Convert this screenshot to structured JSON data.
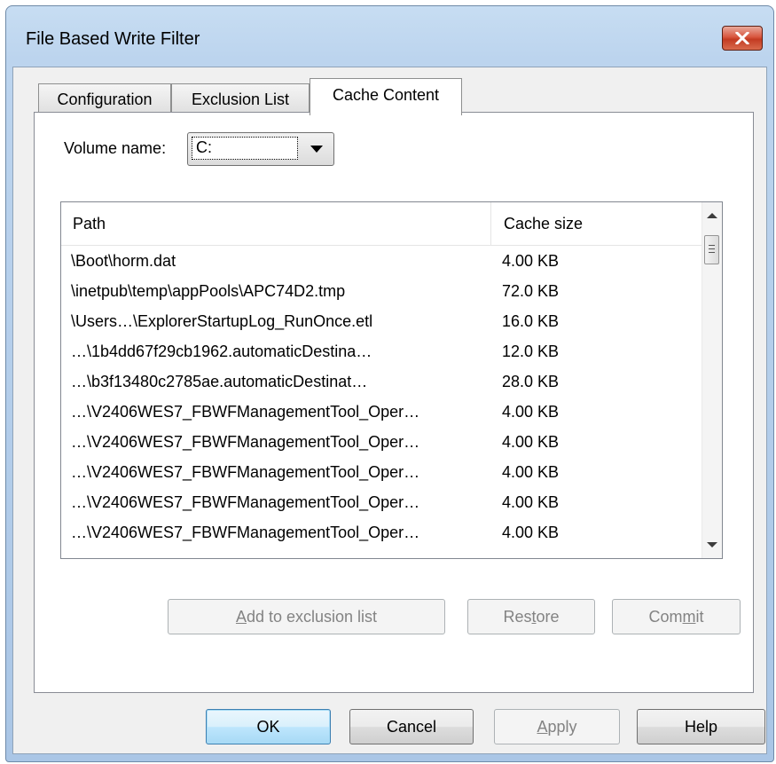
{
  "window": {
    "title": "File Based Write Filter",
    "close_icon": "close-icon"
  },
  "tabs": [
    {
      "label": "Configuration",
      "active": false
    },
    {
      "label": "Exclusion List",
      "active": false
    },
    {
      "label": "Cache Content",
      "active": true
    }
  ],
  "cache_content": {
    "volume_label": "Volume name:",
    "volume_value": "C:",
    "columns": {
      "path": "Path",
      "cache_size": "Cache size"
    },
    "rows": [
      {
        "path": "\\Boot\\horm.dat",
        "size": "4.00 KB"
      },
      {
        "path": "\\inetpub\\temp\\appPools\\APC74D2.tmp",
        "size": "72.0 KB"
      },
      {
        "path": "\\Users…\\ExplorerStartupLog_RunOnce.etl",
        "size": "16.0 KB"
      },
      {
        "path": "…\\1b4dd67f29cb1962.automaticDestina…",
        "size": "12.0 KB"
      },
      {
        "path": "…\\b3f13480c2785ae.automaticDestinat…",
        "size": "28.0 KB"
      },
      {
        "path": "…\\V2406WES7_FBWFManagementTool_Oper…",
        "size": "4.00 KB"
      },
      {
        "path": "…\\V2406WES7_FBWFManagementTool_Oper…",
        "size": "4.00 KB"
      },
      {
        "path": "…\\V2406WES7_FBWFManagementTool_Oper…",
        "size": "4.00 KB"
      },
      {
        "path": "…\\V2406WES7_FBWFManagementTool_Oper…",
        "size": "4.00 KB"
      },
      {
        "path": "…\\V2406WES7_FBWFManagementTool_Oper…",
        "size": "4.00 KB"
      }
    ],
    "buttons": {
      "add_to_exclusion": {
        "pre": "",
        "key": "A",
        "post": "dd to exclusion list"
      },
      "restore": {
        "pre": "Res",
        "key": "t",
        "post": "ore"
      },
      "commit": {
        "pre": "Com",
        "key": "m",
        "post": "it"
      }
    }
  },
  "dialog_buttons": {
    "ok": "OK",
    "cancel": "Cancel",
    "apply": {
      "pre": "",
      "key": "A",
      "post": "pply"
    },
    "help": "Help"
  },
  "colors": {
    "title_gradient_top": "#c7ddf2",
    "close_button_red": "#c33b22",
    "default_button_blue": "#3c7fb1",
    "disabled_text": "#838383"
  }
}
